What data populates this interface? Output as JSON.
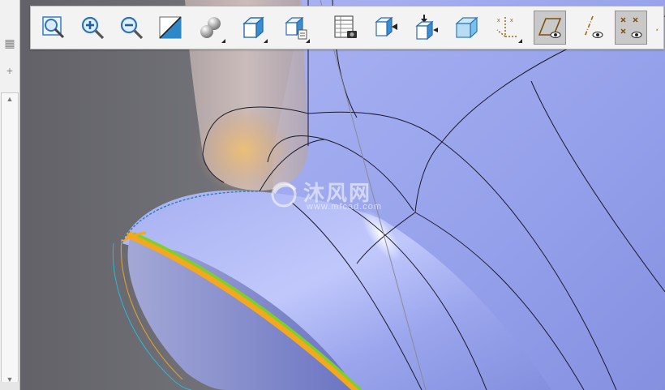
{
  "toolbar": {
    "buttons": [
      {
        "id": "refit",
        "icon": "zoom-fit-icon",
        "active": false,
        "flyout": false
      },
      {
        "id": "zoom-in",
        "icon": "zoom-in-icon",
        "active": false,
        "flyout": false
      },
      {
        "id": "zoom-out",
        "icon": "zoom-out-icon",
        "active": false,
        "flyout": false
      },
      {
        "id": "repaint",
        "icon": "repaint-icon",
        "active": false,
        "flyout": false
      },
      {
        "id": "display-style",
        "icon": "shaded-spheres-icon",
        "active": false,
        "flyout": true
      },
      {
        "id": "saved-orientations",
        "icon": "cube-view-icon",
        "active": false,
        "flyout": true
      },
      {
        "id": "named-views",
        "icon": "view-manager-icon",
        "active": false,
        "flyout": true
      },
      {
        "id": "appearance-gallery",
        "icon": "table-camera-icon",
        "active": false,
        "flyout": false
      },
      {
        "id": "spin-center",
        "icon": "cube-arrow-left-icon",
        "active": false,
        "flyout": false
      },
      {
        "id": "view-normal",
        "icon": "cube-arrow-down-icon",
        "active": false,
        "flyout": false
      },
      {
        "id": "perspective",
        "icon": "transparent-cube-icon",
        "active": false,
        "flyout": false
      },
      {
        "id": "datum-display",
        "icon": "csys-axes-icon",
        "active": false,
        "flyout": true
      },
      {
        "id": "plane-display",
        "icon": "plane-eye-icon",
        "active": true,
        "flyout": false
      },
      {
        "id": "axis-display",
        "icon": "axis-eye-icon",
        "active": false,
        "flyout": false
      },
      {
        "id": "point-display",
        "icon": "points-eye-icon",
        "active": true,
        "flyout": false
      },
      {
        "id": "csys-display",
        "icon": "csys-partial-icon",
        "active": false,
        "flyout": false
      }
    ]
  },
  "side_panel": {
    "icons": [
      "layers-icon",
      "plus-icon"
    ]
  },
  "watermark": {
    "text": "沐风网",
    "url": "www.mfcad.com"
  },
  "colors": {
    "model_blue": "#9aa4ec",
    "highlight_orange": "#f4a820",
    "highlight_green": "#7bd12a",
    "edge_cyan": "#28b8d8",
    "background": "#6f6f74"
  }
}
